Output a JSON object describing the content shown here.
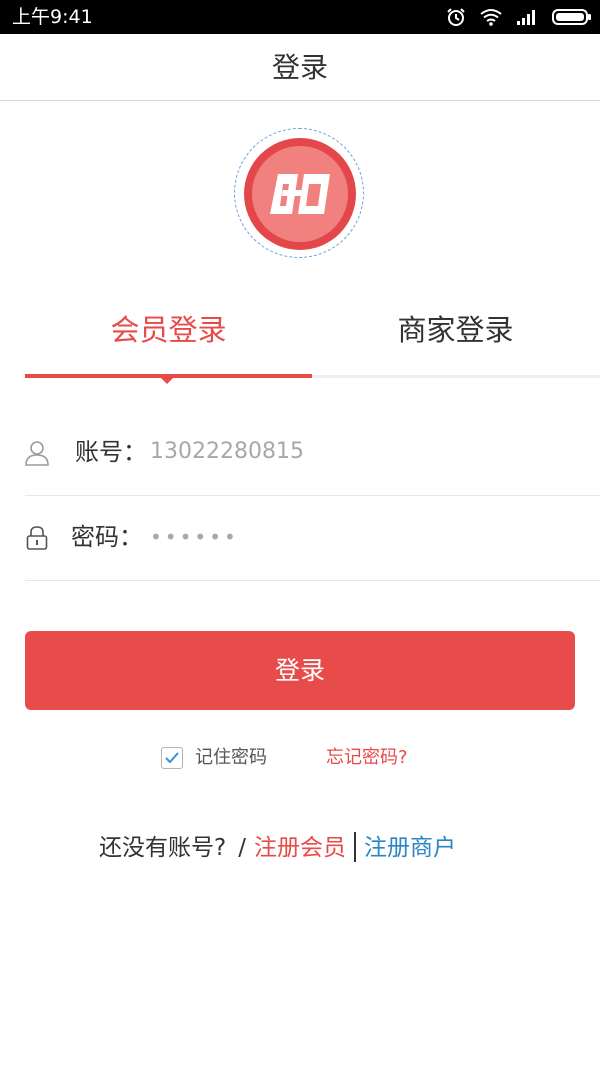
{
  "status_bar": {
    "time": "上午9:41",
    "icons": [
      "alarm-icon",
      "wifi-icon",
      "signal-icon",
      "battery-icon"
    ]
  },
  "header": {
    "title": "登录"
  },
  "logo": {
    "icon": "app-logo-icon"
  },
  "tabs": [
    {
      "label": "会员登录",
      "active": true
    },
    {
      "label": "商家登录",
      "active": false
    }
  ],
  "form": {
    "account": {
      "label": "账号：",
      "value": "13022280815",
      "icon": "user-icon"
    },
    "password": {
      "label": "密码：",
      "value": "••••••",
      "icon": "lock-icon"
    }
  },
  "login_button": {
    "label": "登录"
  },
  "remember": {
    "label": "记住密码",
    "checked": true
  },
  "forgot_password": {
    "label": "忘记密码?"
  },
  "register": {
    "prompt": "还没有账号?",
    "slash": "/",
    "member_label": "注册会员",
    "merchant_label": "注册商户"
  },
  "colors": {
    "accent": "#e84a48",
    "link_blue": "#2b86c5",
    "status_bar": "#000000"
  }
}
